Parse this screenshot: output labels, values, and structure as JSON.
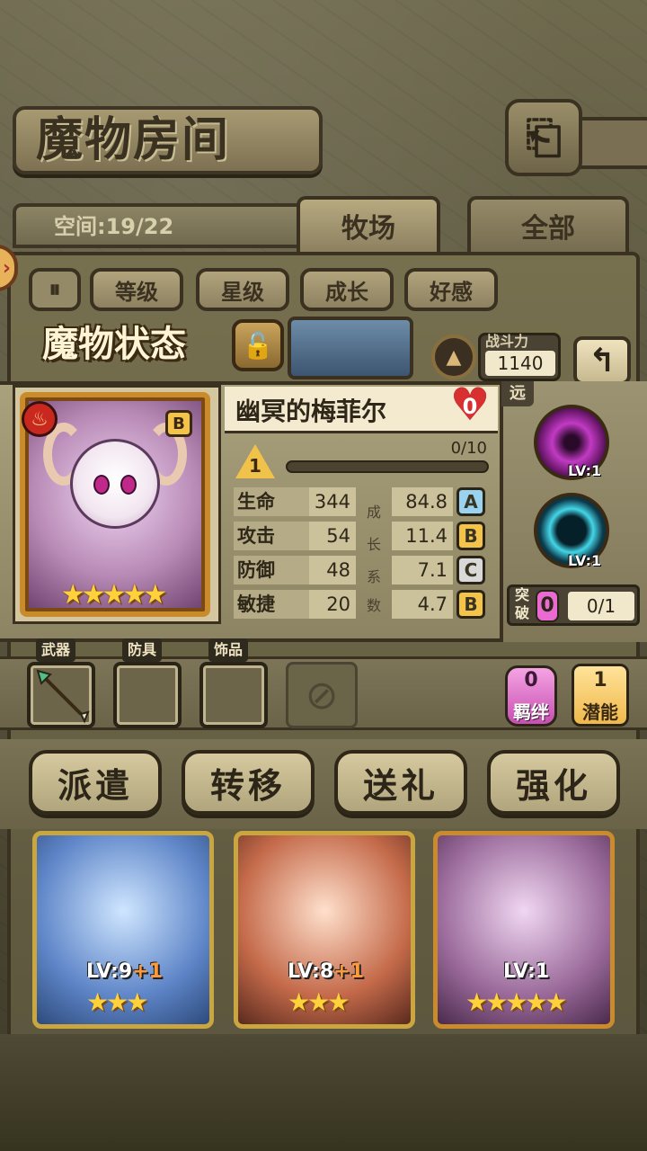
{
  "header": {
    "title": "魔物房间"
  },
  "space": {
    "label": "空间:19/22"
  },
  "tabs": [
    {
      "label": "牧场"
    },
    {
      "label": "全部"
    }
  ],
  "sort": [
    {
      "label": "等级"
    },
    {
      "label": "星级"
    },
    {
      "label": "成长"
    },
    {
      "label": "好感"
    }
  ],
  "status": {
    "title": "魔物状态",
    "power_label": "战斗力",
    "power_value": "1140"
  },
  "monster": {
    "name": "幽冥的梅菲尔",
    "affection": "0",
    "rank": "B",
    "level": "1",
    "exp": "0/10",
    "exp_fraction": 0,
    "stars": "★★★★★",
    "stats": [
      {
        "name": "生命",
        "value": "344",
        "growth": "84.8",
        "grade": "A"
      },
      {
        "name": "攻击",
        "value": "54",
        "growth": "11.4",
        "grade": "B"
      },
      {
        "name": "防御",
        "value": "48",
        "growth": "7.1",
        "grade": "C"
      },
      {
        "name": "敏捷",
        "value": "20",
        "growth": "4.7",
        "grade": "B"
      }
    ],
    "growth_label": [
      "成",
      "长",
      "系",
      "数"
    ]
  },
  "skills": {
    "range": "远",
    "items": [
      {
        "level": "LV:1"
      },
      {
        "level": "LV:1"
      }
    ],
    "break_label": "突破",
    "break_count": "0",
    "break_progress": "0/1"
  },
  "equipment": {
    "labels": [
      "武器",
      "防具",
      "饰品"
    ],
    "bond_count": "0",
    "bond_label": "羁绊",
    "potential_count": "1",
    "potential_label": "潜能"
  },
  "actions": [
    {
      "label": "派遣"
    },
    {
      "label": "转移"
    },
    {
      "label": "送礼"
    },
    {
      "label": "强化"
    }
  ],
  "cards": [
    {
      "level": "LV:9",
      "plus": "+1",
      "stars": "★★★"
    },
    {
      "level": "LV:8",
      "plus": "+1",
      "stars": "★★★"
    },
    {
      "level": "LV:1",
      "plus": "",
      "stars": "★★★★★"
    }
  ],
  "colors": {
    "grade_A": "#9ad3f0",
    "grade_B": "#f4c349",
    "grade_C": "#d9d9d9",
    "accent": "#f1c249"
  }
}
